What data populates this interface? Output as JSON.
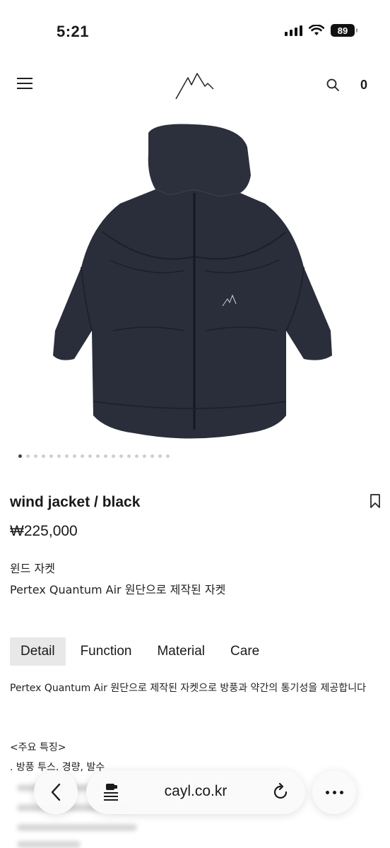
{
  "status_bar": {
    "time": "5:21",
    "battery": "89"
  },
  "header": {
    "cart_count": "0"
  },
  "carousel": {
    "total_slides": 20,
    "active_index": 0
  },
  "product": {
    "name": "wind jacket / black",
    "price": "₩225,000",
    "subtitle": "윈드 자켓",
    "short_description": "Pertex Quantum Air 원단으로 제작된 자켓"
  },
  "tabs": [
    {
      "label": "Detail",
      "active": true
    },
    {
      "label": "Function",
      "active": false
    },
    {
      "label": "Material",
      "active": false
    },
    {
      "label": "Care",
      "active": false
    }
  ],
  "detail": {
    "text": "Pertex Quantum Air 원단으로 제작된 자켓으로 방풍과 약간의 통기성을 제공합니다",
    "features_title": "<주요 특징>",
    "feature_1": ". 방풍 투스, 경량, 발수"
  },
  "browser": {
    "url": "cayl.co.kr"
  },
  "colors": {
    "jacket": "#2a2e3a",
    "text": "#1a1a1a",
    "tab_active_bg": "#e8e8e8"
  }
}
